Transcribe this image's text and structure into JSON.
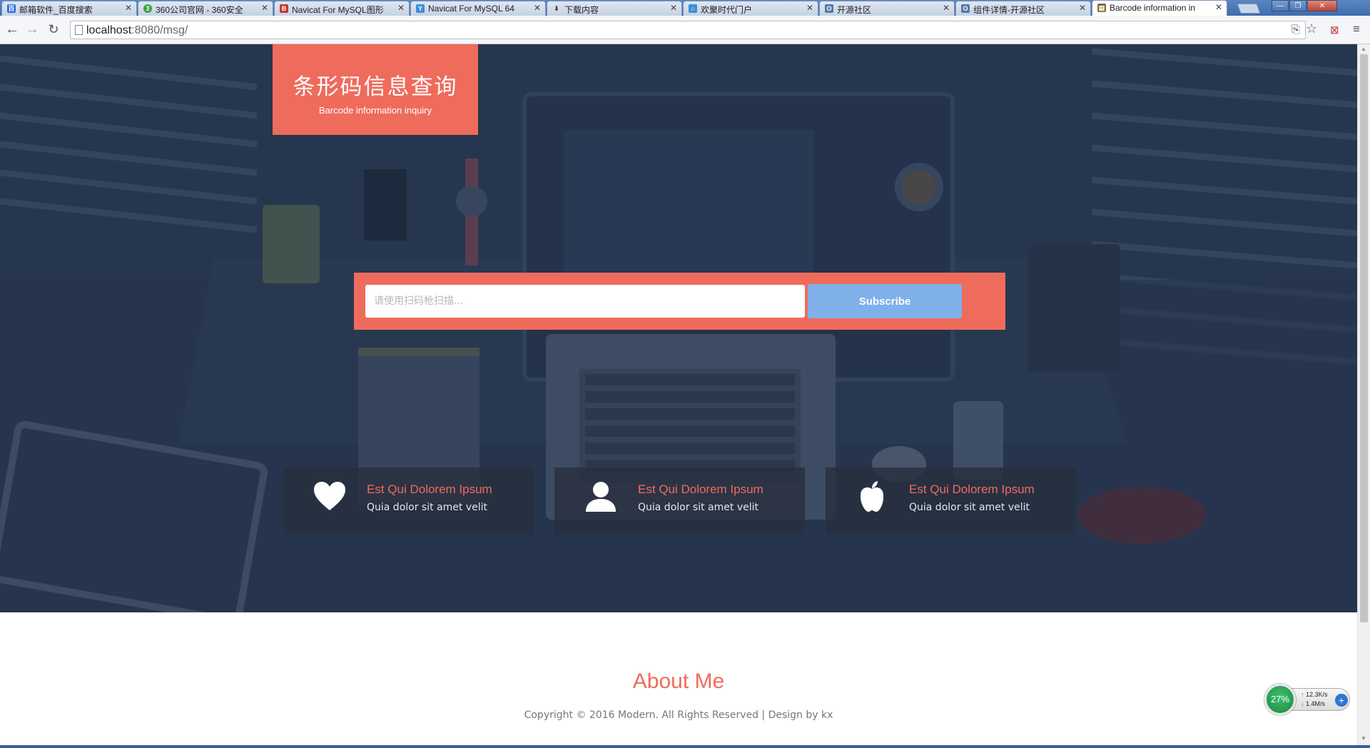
{
  "browser": {
    "tabs": [
      {
        "label": "邮箱软件_百度搜索",
        "favicon_color": "#2f6bd8"
      },
      {
        "label": "360公司官网 - 360安全",
        "favicon_color": "#3ca23c"
      },
      {
        "label": "Navicat For MySQL图形",
        "favicon_color": "#c0392b"
      },
      {
        "label": "Navicat For MySQL 64",
        "favicon_color": "#3a8fd6"
      },
      {
        "label": "下载内容",
        "favicon_color": "#555555"
      },
      {
        "label": "欢聚时代门户",
        "favicon_color": "#3a8fd6"
      },
      {
        "label": "开源社区",
        "favicon_color": "#5577aa"
      },
      {
        "label": "组件详情-开源社区",
        "favicon_color": "#5577aa"
      },
      {
        "label": "Barcode information in",
        "favicon_color": "#8a6a3a",
        "active": true
      }
    ],
    "url_host": "localhost",
    "url_rest": ":8080/msg/"
  },
  "hero": {
    "logo_title": "条形码信息查询",
    "logo_subtitle": "Barcode information inquiry",
    "search_placeholder": "请使用扫码枪扫描...",
    "subscribe_label": "Subscribe",
    "features": [
      {
        "icon": "heart-icon",
        "title": "Est Qui Dolorem Ipsum",
        "text": "Quia dolor sit amet velit"
      },
      {
        "icon": "user-icon",
        "title": "Est Qui Dolorem Ipsum",
        "text": "Quia dolor sit amet velit"
      },
      {
        "icon": "apple-icon",
        "title": "Est Qui Dolorem Ipsum",
        "text": "Quia dolor sit amet velit"
      }
    ]
  },
  "footer": {
    "about_title": "About Me",
    "copyright": "Copyright © 2016 Modern. All Rights Reserved | Design by kx"
  },
  "net_widget": {
    "percent": "27%",
    "upload": "12.3K/s",
    "download": "1.4M/s"
  },
  "colors": {
    "accent": "#ef6b5c",
    "button": "#7fb0ea",
    "hero_bg": "#2d3d55"
  }
}
